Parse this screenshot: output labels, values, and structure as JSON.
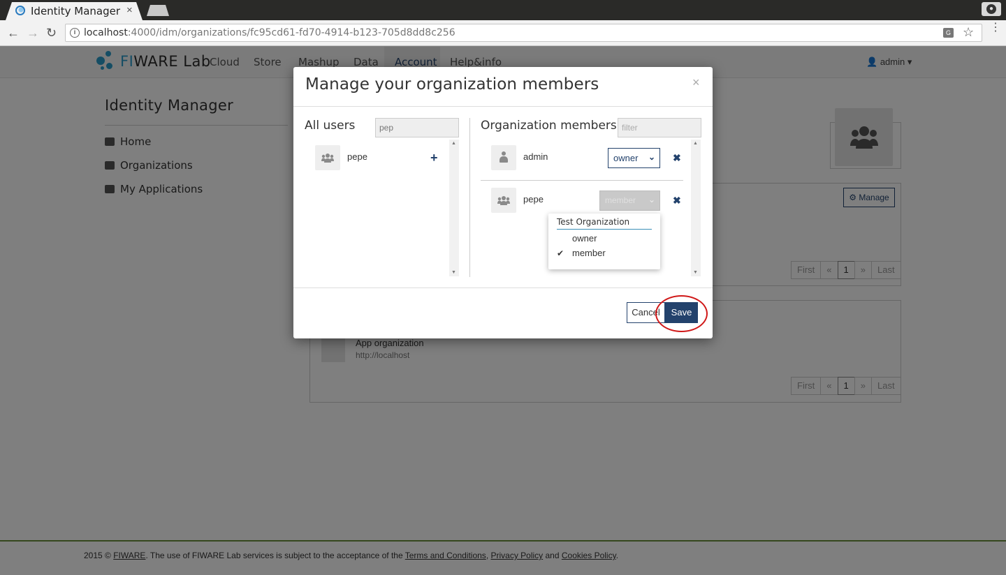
{
  "browser": {
    "tab_title": "Identity Manager",
    "tab_close": "×",
    "url_host": "localhost",
    "url_rest": ":4000/idm/organizations/fc95cd61-fd70-4914-b123-705d8dd8c256",
    "back": "←",
    "forward": "→",
    "reload": "↻",
    "star": "☆",
    "menu": "⋮"
  },
  "site": {
    "logo_fi": "FI",
    "logo_rest": "WARE Lab",
    "nav": [
      "Cloud",
      "Store",
      "Mashup",
      "Data",
      "Account",
      "Help&info"
    ],
    "active_nav": "Account",
    "user": "admin ▾"
  },
  "sidebar": {
    "title": "Identity Manager",
    "items": [
      {
        "label": "Home",
        "icon": "home-icon"
      },
      {
        "label": "Organizations",
        "icon": "users-icon"
      },
      {
        "label": "My Applications",
        "icon": "cube-icon"
      }
    ]
  },
  "main": {
    "manage_label": "Manage",
    "pager": [
      "First",
      "«",
      "1",
      "»",
      "Last"
    ],
    "app_name": "App organization",
    "app_url": "http://localhost"
  },
  "modal": {
    "title": "Manage your organization members",
    "close": "×",
    "all_users_title": "All users",
    "all_users_filter_value": "pep",
    "members_title": "Organization members",
    "members_filter_placeholder": "filter",
    "all_users": [
      {
        "name": "pepe"
      }
    ],
    "add_symbol": "+",
    "members": [
      {
        "name": "admin",
        "role": "owner"
      },
      {
        "name": "pepe",
        "role": "member"
      }
    ],
    "remove_symbol": "✖",
    "chevron": "⌄",
    "dropdown": {
      "header": "Test Organization",
      "options": [
        "owner",
        "member"
      ],
      "selected": "member",
      "check": "✔"
    },
    "cancel_label": "Cancel",
    "save_label": "Save"
  },
  "footer": {
    "prefix": "2015 © ",
    "fiware": "FIWARE",
    "mid": ". The use of FIWARE Lab services is subject to the acceptance of the ",
    "terms": "Terms and Conditions",
    "comma": ", ",
    "privacy": "Privacy Policy",
    "and": " and ",
    "cookies": "Cookies Policy",
    "end": "."
  },
  "colors": {
    "brand": "#23426c",
    "accent": "#2a9bc9",
    "highlight": "#d01818"
  }
}
